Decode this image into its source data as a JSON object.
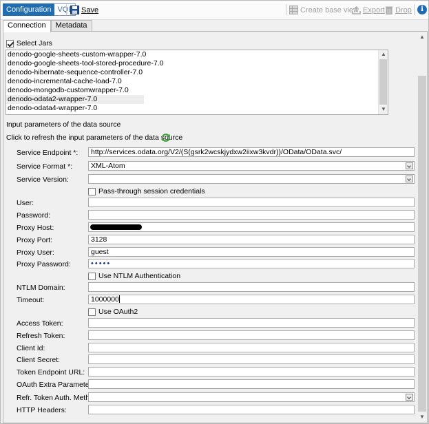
{
  "toolbar": {
    "mode_configuration": "Configuration",
    "mode_vql": "VQL",
    "save_label": "Save",
    "create_base_view_label": "Create base view",
    "export_label": "Export",
    "drop_label": "Drop",
    "info_glyph": "i",
    "accent_color": "#1f6cb1"
  },
  "tabs": [
    {
      "label": "Connection",
      "active": true
    },
    {
      "label": "Metadata",
      "active": false
    }
  ],
  "select_jars": {
    "label": "Select Jars",
    "checked": true
  },
  "jars": [
    "denodo-google-sheets-custom-wrapper-7.0",
    "denodo-google-sheets-tool-stored-procedure-7.0",
    "denodo-hibernate-sequence-controller-7.0",
    "denodo-incremental-cache-load-7.0",
    "denodo-mongodb-customwrapper-7.0",
    "denodo-odata2-wrapper-7.0",
    "denodo-odata4-wrapper-7.0"
  ],
  "selected_jar": "denodo-odata2-wrapper-7.0",
  "section_title": "Input parameters of the data source",
  "refresh_text": "Click to refresh the input parameters of the data source",
  "form": {
    "service_endpoint_label": "Service Endpoint *:",
    "service_endpoint_value": "http://services.odata.org/V2/(S(gsrk2wcskjydxw2iixw3kvdr))/OData/OData.svc/",
    "service_format_label": "Service Format *:",
    "service_format_value": "XML-Atom",
    "service_version_label": "Service Version:",
    "service_version_value": "",
    "pass_through_label": "Pass-through session credentials",
    "user_label": "User:",
    "user_value": "",
    "password_label": "Password:",
    "password_value": "",
    "proxy_host_label": "Proxy Host:",
    "proxy_port_label": "Proxy Port:",
    "proxy_port_value": "3128",
    "proxy_user_label": "Proxy User:",
    "proxy_user_value": "guest",
    "proxy_password_label": "Proxy Password:",
    "proxy_password_value": "•••••",
    "use_ntlm_label": "Use NTLM Authentication",
    "ntlm_domain_label": "NTLM Domain:",
    "ntlm_domain_value": "",
    "timeout_label": "Timeout:",
    "timeout_value": "1000000",
    "use_oauth2_label": "Use OAuth2",
    "access_token_label": "Access Token:",
    "refresh_token_label": "Refresh Token:",
    "client_id_label": "Client Id:",
    "client_secret_label": "Client Secret:",
    "token_endpoint_url_label": "Token Endpoint URL:",
    "oauth_extra_params_label": "OAuth Extra Parameters:",
    "refr_token_auth_method_label": "Refr. Token Auth. Method:",
    "refr_token_auth_method_value": "",
    "http_headers_label": "HTTP Headers:"
  }
}
